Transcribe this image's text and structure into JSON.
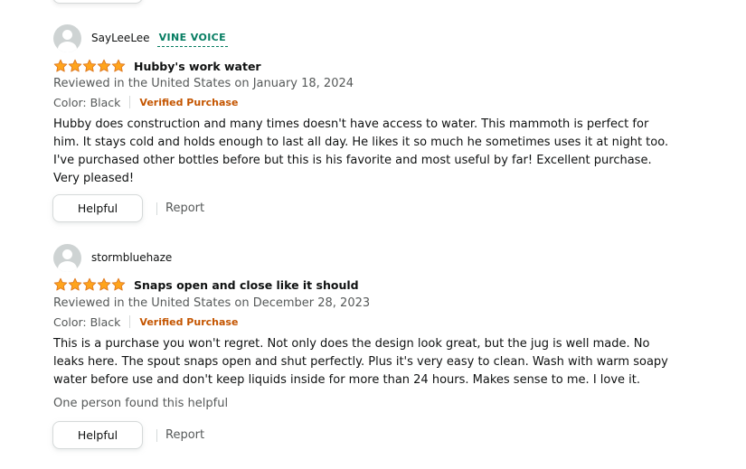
{
  "colors": {
    "star": "#ffa41c",
    "star_outline": "#de7921",
    "verified": "#c45500",
    "vine": "#067d62",
    "muted_text": "#565959"
  },
  "reviews": [
    {
      "profile_name": "SayLeeLee",
      "badge": "VINE VOICE",
      "rating": 5,
      "rating_max": 5,
      "title": "Hubby's work water",
      "date_line": "Reviewed in the United States on January 18, 2024",
      "format": "Color: Black",
      "verified": "Verified Purchase",
      "body": "Hubby does construction and many times doesn't have access to water. This mammoth is perfect for him. It stays cold and holds enough to last all day. He likes it so much he sometimes uses it at night too. I've purchased other bottles before but this is his favorite and most useful by far! Excellent purchase. Very pleased!",
      "helpful_statement": "",
      "helpful_label": "Helpful",
      "report_label": "Report"
    },
    {
      "profile_name": "stormbluehaze",
      "badge": "",
      "rating": 5,
      "rating_max": 5,
      "title": "Snaps open and close like it should",
      "date_line": "Reviewed in the United States on December 28, 2023",
      "format": "Color: Black",
      "verified": "Verified Purchase",
      "body": "This is a purchase you won't regret. Not only does the design look great, but the jug is well made. No leaks here. The spout snaps open and shut perfectly. Plus it's very easy to clean. Wash with warm soapy water before use and don't keep liquids inside for more than 24 hours. Makes sense to me. I love it.",
      "helpful_statement": "One person found this helpful",
      "helpful_label": "Helpful",
      "report_label": "Report"
    }
  ]
}
